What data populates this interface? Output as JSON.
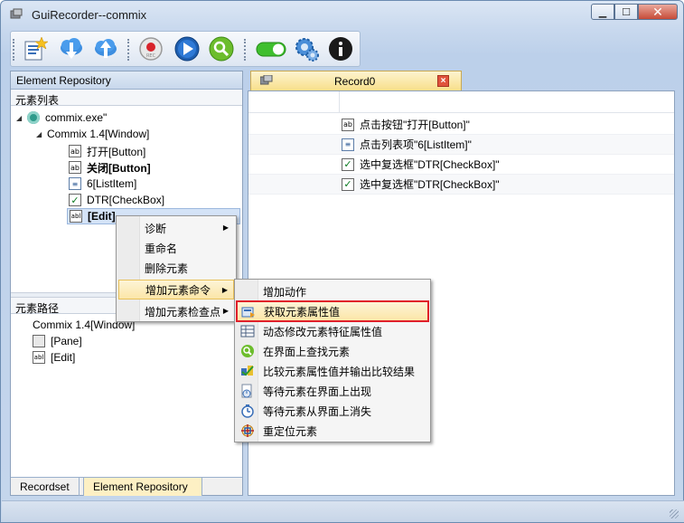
{
  "window": {
    "title": "GuiRecorder--commix",
    "minimize_label": "▁",
    "maximize_label": "☐",
    "close_label": "✕"
  },
  "toolbar": {
    "icons": [
      "new-record-icon",
      "download-icon",
      "upload-icon",
      "record-icon",
      "play-icon",
      "search-icon",
      "toggle-icon",
      "settings-icon",
      "info-icon"
    ]
  },
  "left_panel": {
    "header": "Element Repository",
    "element_list_label": "元素列表",
    "tree": [
      {
        "label": "commix.exe\"",
        "icon": "app-icon"
      },
      {
        "label": "Commix 1.4[Window]",
        "icon": ""
      },
      {
        "label": "打开[Button]",
        "icon": "ab",
        "bold": false
      },
      {
        "label": "关闭[Button]",
        "icon": "ab",
        "bold": true
      },
      {
        "label": "6[ListItem]",
        "icon": "list",
        "bold": false
      },
      {
        "label": "DTR[CheckBox]",
        "icon": "check",
        "bold": false
      },
      {
        "label": "[Edit]",
        "icon": "abl",
        "bold": true
      }
    ],
    "element_path_label": "元素路径",
    "path": [
      {
        "label": "Commix 1.4[Window]",
        "icon": ""
      },
      {
        "label": "[Pane]",
        "icon": "pane"
      },
      {
        "label": "[Edit]",
        "icon": "abl"
      }
    ],
    "tabs": [
      "Recordset",
      "Element Repository"
    ]
  },
  "record": {
    "tab_label": "Record0",
    "close_label": "×",
    "steps": [
      {
        "label": "点击按钮\"打开[Button]\"",
        "icon": "ab"
      },
      {
        "label": "点击列表项\"6[ListItem]\"",
        "icon": "list"
      },
      {
        "label": "选中复选框\"DTR[CheckBox]\"",
        "icon": "check"
      },
      {
        "label": "选中复选框\"DTR[CheckBox]\"",
        "icon": "check"
      }
    ]
  },
  "context_menu": {
    "items": [
      {
        "label": "诊断",
        "submenu": true
      },
      {
        "label": "重命名",
        "submenu": false
      },
      {
        "label": "删除元素",
        "submenu": false
      },
      {
        "label": "增加元素命令",
        "submenu": true,
        "active": true
      },
      {
        "label": "增加元素检查点",
        "submenu": true
      }
    ]
  },
  "submenu": {
    "items": [
      {
        "label": "增加动作",
        "icon": ""
      },
      {
        "label": "获取元素属性值",
        "icon": "get-property-icon",
        "highlighted": true
      },
      {
        "label": "动态修改元素特征属性值",
        "icon": "table-icon"
      },
      {
        "label": "在界面上查找元素",
        "icon": "find-icon"
      },
      {
        "label": "比较元素属性值并输出比较结果",
        "icon": "compare-icon"
      },
      {
        "label": "等待元素在界面上出现",
        "icon": "wait-appear-icon"
      },
      {
        "label": "等待元素从界面上消失",
        "icon": "wait-disappear-icon"
      },
      {
        "label": "重定位元素",
        "icon": "relocate-icon"
      }
    ]
  },
  "colors": {
    "accent": "#3a6fb8",
    "highlight_border": "#e0202a",
    "menu_hover": "#fbe6a8"
  }
}
